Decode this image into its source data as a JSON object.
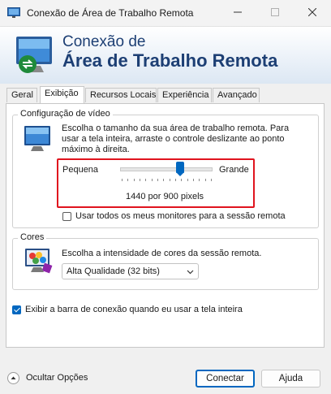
{
  "window": {
    "title": "Conexão de Área de Trabalho Remota",
    "controls": {
      "minimize_icon": "minimize-icon",
      "maximize_icon": "maximize-icon",
      "close_icon": "close-icon"
    }
  },
  "banner": {
    "line1": "Conexão de",
    "line2": "Área de Trabalho Remota",
    "logo_icon": "remote-desktop-logo-icon"
  },
  "tabs": [
    {
      "label": "Geral",
      "active": false
    },
    {
      "label": "Exibição",
      "active": true
    },
    {
      "label": "Recursos Locais",
      "active": false
    },
    {
      "label": "Experiência",
      "active": false
    },
    {
      "label": "Avançado",
      "active": false
    }
  ],
  "video": {
    "legend": "Configuração de vídeo",
    "description": "Escolha o tamanho da sua área de trabalho remota. Para usar a tela inteira, arraste o controle deslizante ao ponto máximo à direita.",
    "slider_min_label": "Pequena",
    "slider_max_label": "Grande",
    "resolution": "1440 por 900 pixels",
    "slider_value_fraction": 0.65,
    "multi_monitor_label": "Usar todos os meus monitores para a sessão remota",
    "multi_monitor_checked": false,
    "monitor_icon": "monitor-icon"
  },
  "colors": {
    "legend": "Cores",
    "description": "Escolha a intensidade de cores da sessão remota.",
    "selected": "Alta Qualidade (32 bits)",
    "palette_icon": "color-palette-icon"
  },
  "connection_bar": {
    "label": "Exibir a barra de conexão quando eu usar a tela inteira",
    "checked": true
  },
  "footer": {
    "hide_options_label": "Ocultar Opções",
    "connect_label": "Conectar",
    "help_label": "Ajuda"
  },
  "theme": {
    "accent": "#0067c0",
    "highlight_border": "#e0141e",
    "banner_text": "#1d3f74"
  }
}
